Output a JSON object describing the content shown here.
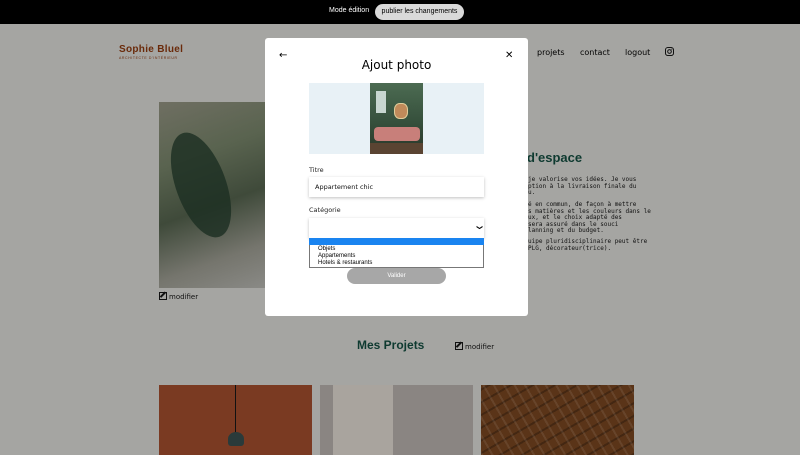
{
  "edit_bar": {
    "mode_label": "Mode édition",
    "publish_label": "publier les changements"
  },
  "header": {
    "logo": "Sophie Bluel",
    "logo_subtitle": "ARCHITECTE D'INTÉRIEUR",
    "nav": [
      "projets",
      "contact",
      "logout"
    ],
    "social_icon": "instagram-icon"
  },
  "background": {
    "modify_label": "modifier",
    "about_title": "d'espace",
    "about_lines_1": [
      "je valorise vos idées. Je vous",
      "ption à la livraison finale du",
      "u."
    ],
    "about_lines_2": [
      "é en commun, de façon à mettre",
      "s matières et les couleurs dans le",
      "ux, et le choix adapté des",
      "sera assuré dans le souci",
      "lanning et du budget."
    ],
    "about_lines_3": [
      "uipe pluridisciplinaire peut être",
      "PLG, décorateur(trice)."
    ],
    "projects_title": "Mes Projets"
  },
  "modal": {
    "title": "Ajout photo",
    "back_icon": "arrow-left-icon",
    "close_icon": "close-icon",
    "title_label": "Titre",
    "title_value": "Appartement chic",
    "category_label": "Catégorie",
    "category_options": [
      "Objets",
      "Appartements",
      "Hotels & restaurants"
    ],
    "validate_label": "Valider"
  },
  "colors": {
    "brand": "#b1663c",
    "heading_green": "#1d6154",
    "dropdown_highlight": "#1a84f0",
    "preview_bg": "#e8f1f6"
  }
}
